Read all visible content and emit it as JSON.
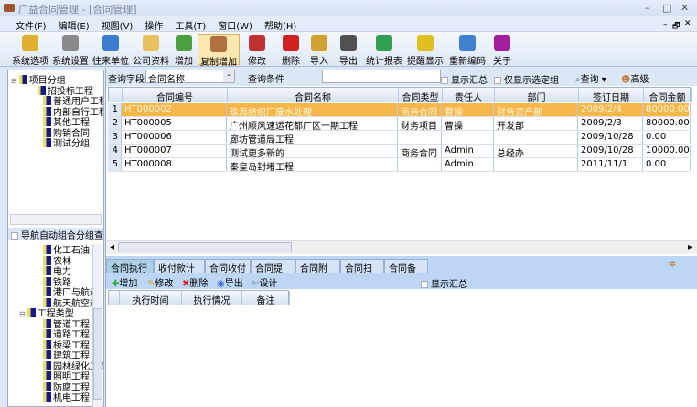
{
  "window": {
    "title": "广益合同管理 - [合同管理]",
    "minimize": "–",
    "maximize": "□",
    "close": "✕",
    "child_min": "–",
    "child_restore": "🗗",
    "child_close": "✕"
  },
  "menu": [
    "文件(F)",
    "编辑(E)",
    "视图(V)",
    "操作",
    "工具(T)",
    "窗口(W)",
    "帮助(H)"
  ],
  "toolbar": [
    {
      "label": "系统选项",
      "icon": "key-icon",
      "color": "#e0b030"
    },
    {
      "label": "系统设置",
      "icon": "tools-icon",
      "color": "#8a8a8a"
    },
    {
      "label": "往来单位",
      "icon": "person-icon",
      "color": "#3b7bd0"
    },
    {
      "label": "公司资料",
      "icon": "folder-icon",
      "color": "#e8c060"
    },
    {
      "label": "增加",
      "icon": "add-user-icon",
      "color": "#4aa040"
    },
    {
      "label": "复制增加",
      "icon": "copy-add-icon",
      "color": "#b07040"
    },
    {
      "label": "修改",
      "icon": "pen-icon",
      "color": "#c03030"
    },
    {
      "label": "删除",
      "icon": "delete-icon",
      "color": "#d02020"
    },
    {
      "label": "导入",
      "icon": "import-icon",
      "color": "#d0a030"
    },
    {
      "label": "导出",
      "icon": "printer-icon",
      "color": "#505050"
    },
    {
      "label": "统计报表",
      "icon": "chart-icon",
      "color": "#30a050"
    },
    {
      "label": "提醒显示",
      "icon": "warning-icon",
      "color": "#e0c020"
    },
    {
      "label": "重新编码",
      "icon": "recode-icon",
      "color": "#4080d0"
    },
    {
      "label": "关于",
      "icon": "help-icon",
      "color": "#a020a0"
    }
  ],
  "tree_top": {
    "root": "项目分组",
    "items": [
      "招投标工程",
      "普通用户工程",
      "内部自行工程",
      "其他工程",
      "购销合同",
      "测试分组"
    ]
  },
  "nav_checkbox": "导航自动组合分组查询",
  "tree_bottom": {
    "items_a": [
      "化工石油",
      "农林",
      "电力",
      "铁路",
      "港口与航道",
      "航天航空通"
    ],
    "root": "工程类型",
    "items_b": [
      "管道工程",
      "道路工程",
      "桥梁工程",
      "建筑工程",
      "园林绿化工程",
      "照明工程",
      "防腐工程",
      "机电工程"
    ]
  },
  "search": {
    "field_label": "查询字段",
    "field_value": "合同名称",
    "cond_label": "查询条件",
    "cond_value": "",
    "show_sum": "显示汇总",
    "only_selected": "仅显示选定组",
    "query": "查询",
    "advanced": "高级"
  },
  "grid": {
    "columns": [
      "合同编号",
      "合同名称",
      "合同类型",
      "责任人",
      "部门",
      "签订日期",
      "合同金额"
    ],
    "rows": [
      [
        "1",
        "HT000002",
        "珠海纺织厂废水处理",
        "商务合同",
        "曹操",
        "财务资产部",
        "2009/2/4",
        "80000.00"
      ],
      [
        "2",
        "HT000005",
        "广州顺风速运花都厂区一期工程",
        "财务项目",
        "曹操",
        "开发部",
        "2009/2/3",
        "80000.00"
      ],
      [
        "3",
        "HT000006",
        "廊坊管道局工程",
        "",
        "",
        "",
        "2009/10/28",
        "0.00"
      ],
      [
        "4",
        "HT000007",
        "测试更多新的",
        "商务合同",
        "Admin",
        "总经办",
        "2009/10/28",
        "10000.00"
      ],
      [
        "5",
        "HT000008",
        "秦皇岛封堵工程",
        "",
        "Admin",
        "",
        "2011/11/1",
        "0.00"
      ]
    ],
    "selected_row": 1
  },
  "tabs": [
    "合同执行",
    "收付款计划",
    "合同收付",
    "合同提醒",
    "合同附件",
    "合同扫描",
    "合同备注"
  ],
  "active_tab": 0,
  "sub_toolbar": {
    "add": "增加",
    "edit": "修改",
    "delete": "删除",
    "export": "导出",
    "design": "设计",
    "show_sum": "显示汇总"
  },
  "sub_grid": {
    "columns": [
      "执行时间",
      "执行情况",
      "备注"
    ]
  }
}
